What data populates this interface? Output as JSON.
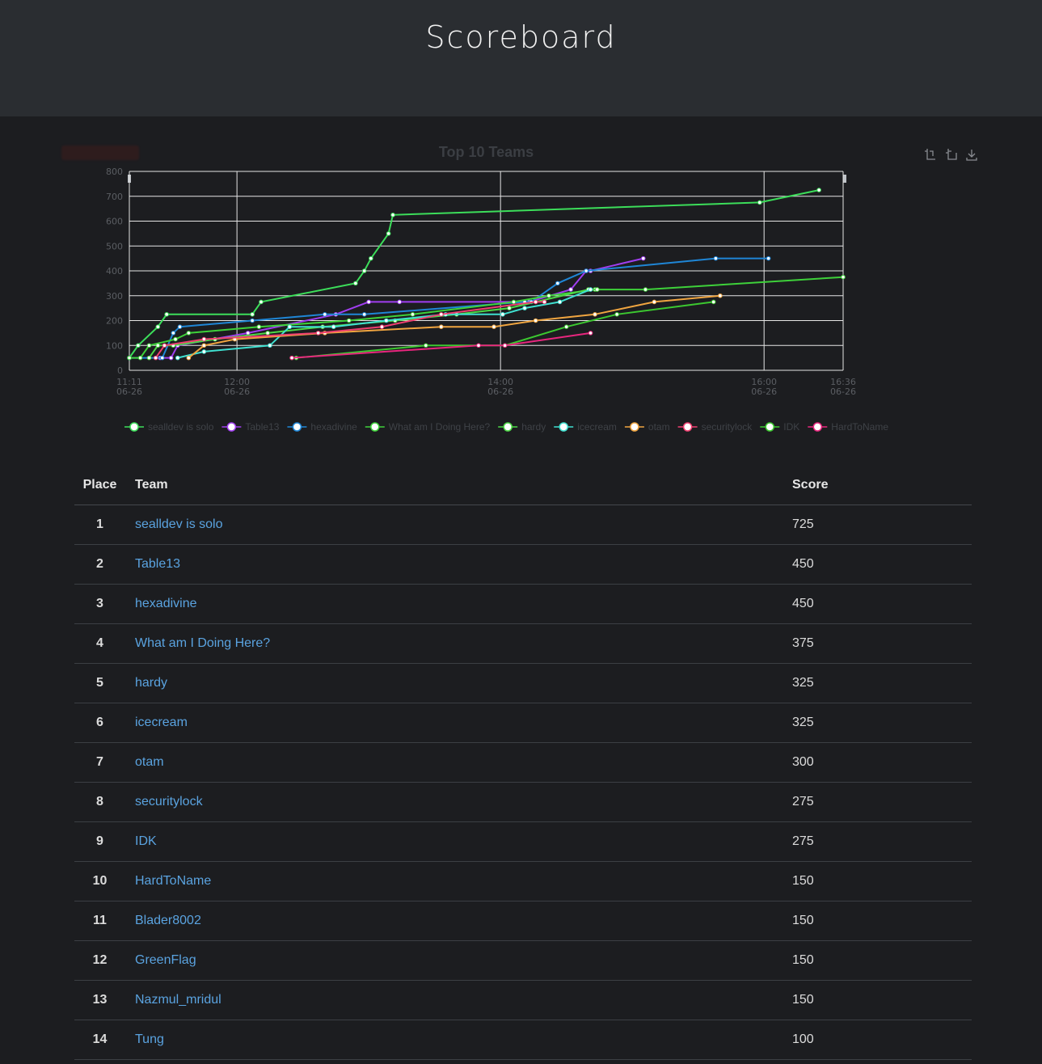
{
  "page_title": "Scoreboard",
  "table": {
    "headers": {
      "place": "Place",
      "team": "Team",
      "score": "Score"
    },
    "rows": [
      {
        "place": "1",
        "team": "sealldev is solo",
        "score": "725"
      },
      {
        "place": "2",
        "team": "Table13",
        "score": "450"
      },
      {
        "place": "3",
        "team": "hexadivine",
        "score": "450"
      },
      {
        "place": "4",
        "team": "What am I Doing Here?",
        "score": "375"
      },
      {
        "place": "5",
        "team": "hardy",
        "score": "325"
      },
      {
        "place": "6",
        "team": "icecream",
        "score": "325"
      },
      {
        "place": "7",
        "team": "otam",
        "score": "300"
      },
      {
        "place": "8",
        "team": "securitylock",
        "score": "275"
      },
      {
        "place": "9",
        "team": "IDK",
        "score": "275"
      },
      {
        "place": "10",
        "team": "HardToName",
        "score": "150"
      },
      {
        "place": "11",
        "team": "Blader8002",
        "score": "150"
      },
      {
        "place": "12",
        "team": "GreenFlag",
        "score": "150"
      },
      {
        "place": "13",
        "team": "Nazmul_mridul",
        "score": "150"
      },
      {
        "place": "14",
        "team": "Tung",
        "score": "100"
      }
    ]
  },
  "toolbox": {
    "icons": [
      "zoom-icon",
      "zoom-reset-icon",
      "download-icon"
    ]
  },
  "chart_data": {
    "type": "line",
    "title": "Top 10 Teams",
    "xlabel": "",
    "ylabel": "",
    "ylim": [
      0,
      800
    ],
    "yticks": [
      0,
      100,
      200,
      300,
      400,
      500,
      600,
      700,
      800
    ],
    "xlim": [
      "11:11",
      "16:36"
    ],
    "xticks": [
      {
        "t": "11:11",
        "label": [
          "11:11",
          "06-26"
        ]
      },
      {
        "t": "12:00",
        "label": [
          "12:00",
          "06-26"
        ]
      },
      {
        "t": "14:00",
        "label": [
          "14:00",
          "06-26"
        ]
      },
      {
        "t": "16:00",
        "label": [
          "16:00",
          "06-26"
        ]
      },
      {
        "t": "16:36",
        "label": [
          "16:36",
          "06-26"
        ]
      }
    ],
    "grid": true,
    "legend_position": "bottom",
    "dataZoom": "top",
    "series": [
      {
        "name": "sealldev is solo",
        "color": "#3cde5a",
        "points": [
          [
            "11:11",
            50
          ],
          [
            "11:15",
            100
          ],
          [
            "11:24",
            175
          ],
          [
            "11:28",
            225
          ],
          [
            "12:07",
            225
          ],
          [
            "12:11",
            275
          ],
          [
            "12:54",
            350
          ],
          [
            "12:58",
            400
          ],
          [
            "13:01",
            450
          ],
          [
            "13:09",
            550
          ],
          [
            "13:11",
            625
          ],
          [
            "15:58",
            675
          ],
          [
            "16:25",
            725
          ]
        ]
      },
      {
        "name": "Table13",
        "color": "#a03ef0",
        "points": [
          [
            "11:25",
            50
          ],
          [
            "11:30",
            50
          ],
          [
            "11:33",
            100
          ],
          [
            "12:05",
            150
          ],
          [
            "12:45",
            225
          ],
          [
            "13:00",
            275
          ],
          [
            "13:14",
            275
          ],
          [
            "14:13",
            275
          ],
          [
            "14:32",
            325
          ],
          [
            "14:39",
            400
          ],
          [
            "14:41",
            400
          ],
          [
            "15:05",
            450
          ]
        ]
      },
      {
        "name": "hexadivine",
        "color": "#1f86d6",
        "points": [
          [
            "11:11",
            50
          ],
          [
            "11:26",
            50
          ],
          [
            "11:31",
            150
          ],
          [
            "11:34",
            175
          ],
          [
            "12:07",
            200
          ],
          [
            "12:40",
            225
          ],
          [
            "12:58",
            225
          ],
          [
            "14:11",
            275
          ],
          [
            "14:14",
            275
          ],
          [
            "14:26",
            350
          ],
          [
            "14:39",
            400
          ],
          [
            "15:38",
            450
          ],
          [
            "16:02",
            450
          ]
        ]
      },
      {
        "name": "What am I Doing Here?",
        "color": "#3ed13a",
        "points": [
          [
            "11:11",
            50
          ],
          [
            "11:16",
            50
          ],
          [
            "11:20",
            100
          ],
          [
            "11:32",
            125
          ],
          [
            "11:38",
            150
          ],
          [
            "12:10",
            175
          ],
          [
            "12:51",
            200
          ],
          [
            "13:20",
            225
          ],
          [
            "14:06",
            275
          ],
          [
            "14:22",
            300
          ],
          [
            "14:43",
            325
          ],
          [
            "15:06",
            325
          ],
          [
            "16:36",
            375
          ]
        ]
      },
      {
        "name": "hardy",
        "color": "#4cd846",
        "points": [
          [
            "11:20",
            50
          ],
          [
            "11:24",
            100
          ],
          [
            "11:31",
            100
          ],
          [
            "11:50",
            125
          ],
          [
            "12:14",
            150
          ],
          [
            "12:39",
            175
          ],
          [
            "13:12",
            200
          ],
          [
            "13:40",
            225
          ],
          [
            "14:04",
            250
          ],
          [
            "14:40",
            325
          ],
          [
            "14:44",
            325
          ]
        ]
      },
      {
        "name": "icecream",
        "color": "#3fe0d0",
        "points": [
          [
            "11:33",
            50
          ],
          [
            "11:45",
            75
          ],
          [
            "12:15",
            100
          ],
          [
            "12:24",
            175
          ],
          [
            "12:44",
            175
          ],
          [
            "13:08",
            200
          ],
          [
            "13:35",
            225
          ],
          [
            "14:01",
            225
          ],
          [
            "14:11",
            250
          ],
          [
            "14:27",
            275
          ],
          [
            "14:41",
            325
          ]
        ]
      },
      {
        "name": "otam",
        "color": "#f0a540",
        "points": [
          [
            "11:38",
            50
          ],
          [
            "11:45",
            100
          ],
          [
            "11:59",
            125
          ],
          [
            "12:40",
            150
          ],
          [
            "13:33",
            175
          ],
          [
            "13:57",
            175
          ],
          [
            "14:16",
            200
          ],
          [
            "14:43",
            225
          ],
          [
            "15:10",
            275
          ],
          [
            "15:40",
            300
          ]
        ]
      },
      {
        "name": "securitylock",
        "color": "#ef3f70",
        "points": [
          [
            "11:23",
            50
          ],
          [
            "11:27",
            100
          ],
          [
            "11:45",
            125
          ],
          [
            "12:37",
            150
          ],
          [
            "13:06",
            175
          ],
          [
            "13:33",
            225
          ],
          [
            "14:16",
            275
          ],
          [
            "14:20",
            275
          ]
        ]
      },
      {
        "name": "IDK",
        "color": "#3cc830",
        "points": [
          [
            "12:25",
            50
          ],
          [
            "12:27",
            50
          ],
          [
            "13:26",
            100
          ],
          [
            "14:02",
            100
          ],
          [
            "14:30",
            175
          ],
          [
            "14:53",
            225
          ],
          [
            "15:37",
            275
          ]
        ]
      },
      {
        "name": "HardToName",
        "color": "#e8267e",
        "points": [
          [
            "12:25",
            50
          ],
          [
            "13:50",
            100
          ],
          [
            "14:02",
            100
          ],
          [
            "14:41",
            150
          ]
        ]
      }
    ]
  }
}
